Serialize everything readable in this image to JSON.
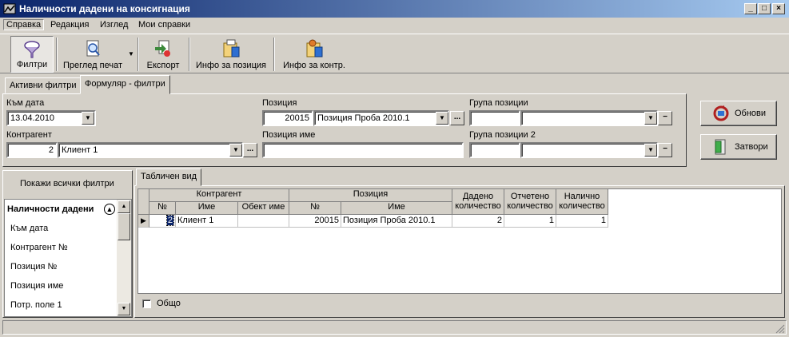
{
  "window": {
    "title": "Наличности дадени на консигнация",
    "controls": [
      "_",
      "□",
      "×"
    ]
  },
  "menu": [
    "Справка",
    "Редакция",
    "Изглед",
    "Мои справки"
  ],
  "toolbar": {
    "filters": "Филтри",
    "print_preview": "Преглед печат",
    "export": "Експорт",
    "item_info": "Инфо за позиция",
    "partner_info": "Инфо за контр."
  },
  "filter_tabs": [
    "Активни филтри",
    "Формуляр - филтри"
  ],
  "form": {
    "date_label": "Към дата",
    "date_value": "13.04.2010",
    "item_label": "Позиция",
    "item_code": "20015",
    "item_name": "Позиция Проба 2010.1",
    "group_label": "Група позиции",
    "group_code": "",
    "group_name": "",
    "partner_label": "Контрагент",
    "partner_code": "2",
    "partner_name": "Клиент 1",
    "item_name_label": "Позиция име",
    "item_name_value": "",
    "group2_label": "Група позиции 2",
    "group2_code": "",
    "group2_name": ""
  },
  "buttons": {
    "refresh": "Обнови",
    "close": "Затвори",
    "ellipsis": "...",
    "minus": "−"
  },
  "left_panel": {
    "show_all": "Покажи всички филтри",
    "list_header": "Наличности дадени",
    "items": [
      "Към дата",
      "Контрагент №",
      "Позиция №",
      "Позиция име",
      "Потр. поле 1"
    ]
  },
  "grid": {
    "tab": "Табличен вид",
    "group_headers": [
      "Контрагент",
      "Позиция"
    ],
    "columns": [
      "№",
      "Име",
      "Обект име",
      "№",
      "Име",
      "Дадено количество",
      "Отчетено количество",
      "Налично количество"
    ],
    "rows": [
      [
        "2",
        "Клиент 1",
        "",
        "20015",
        "Позиция Проба 2010.1",
        "2",
        "1",
        "1"
      ]
    ],
    "total_label": "Общо"
  }
}
